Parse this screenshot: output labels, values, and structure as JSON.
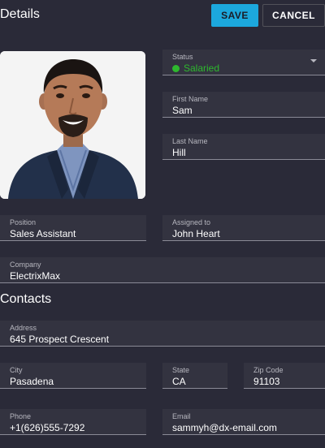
{
  "header": {
    "title": "Details",
    "save_label": "SAVE",
    "cancel_label": "CANCEL"
  },
  "status": {
    "label": "Status",
    "value": "Salaried",
    "color": "#2eb82e"
  },
  "first_name": {
    "label": "First Name",
    "value": "Sam"
  },
  "last_name": {
    "label": "Last Name",
    "value": "Hill"
  },
  "position": {
    "label": "Position",
    "value": "Sales Assistant"
  },
  "assigned_to": {
    "label": "Assigned to",
    "value": "John Heart"
  },
  "company": {
    "label": "Company",
    "value": "ElectrixMax"
  },
  "contacts": {
    "title": "Contacts"
  },
  "address": {
    "label": "Address",
    "value": "645 Prospect Crescent"
  },
  "city": {
    "label": "City",
    "value": "Pasadena"
  },
  "state": {
    "label": "State",
    "value": "CA"
  },
  "zip": {
    "label": "Zip Code",
    "value": "91103"
  },
  "phone": {
    "label": "Phone",
    "value": "+1(626)555-7292"
  },
  "email": {
    "label": "Email",
    "value": "sammyh@dx-email.com"
  },
  "colors": {
    "accent": "#1ca8dd",
    "background": "#2a2a38",
    "field": "#333340"
  }
}
